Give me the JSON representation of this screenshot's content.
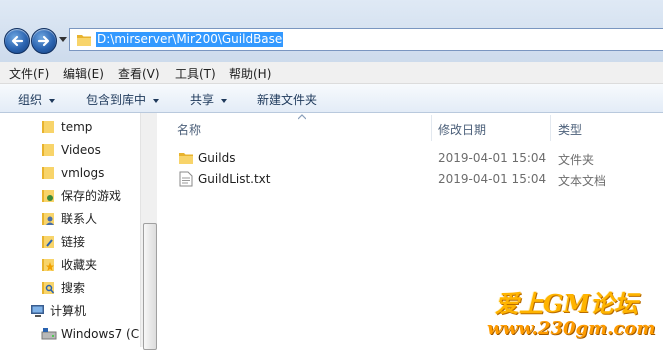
{
  "address": {
    "path": "D:\\mirserver\\Mir200\\GuildBase"
  },
  "menu": [
    "文件(F)",
    "编辑(E)",
    "查看(V)",
    "工具(T)",
    "帮助(H)"
  ],
  "toolbar": {
    "organize": "组织",
    "include_library": "包含到库中",
    "share": "共享",
    "new_folder": "新建文件夹"
  },
  "nav": [
    {
      "label": "temp",
      "icon": "folder-icon"
    },
    {
      "label": "Videos",
      "icon": "folder-icon"
    },
    {
      "label": "vmlogs",
      "icon": "folder-icon"
    },
    {
      "label": "保存的游戏",
      "icon": "saved-games-icon"
    },
    {
      "label": "联系人",
      "icon": "contacts-icon"
    },
    {
      "label": "链接",
      "icon": "links-icon"
    },
    {
      "label": "收藏夹",
      "icon": "favorites-icon"
    },
    {
      "label": "搜索",
      "icon": "search-folder-icon"
    },
    {
      "label": "计算机",
      "icon": "computer-icon"
    },
    {
      "label": "Windows7 (C:",
      "icon": "drive-icon"
    }
  ],
  "columns": {
    "name": "名称",
    "modified": "修改日期",
    "type": "类型"
  },
  "files": [
    {
      "name": "Guilds",
      "modified": "2019-04-01 15:04",
      "type": "文件夹",
      "icon": "folder-icon"
    },
    {
      "name": "GuildList.txt",
      "modified": "2019-04-01 15:04",
      "type": "文本文档",
      "icon": "text-file-icon"
    }
  ],
  "watermark": {
    "line1": "爱上GM论坛",
    "line2": "www.230gm.com"
  },
  "colors": {
    "selection": "#3399ff",
    "folder": "#f5c542",
    "watermark": "#ffb400"
  }
}
